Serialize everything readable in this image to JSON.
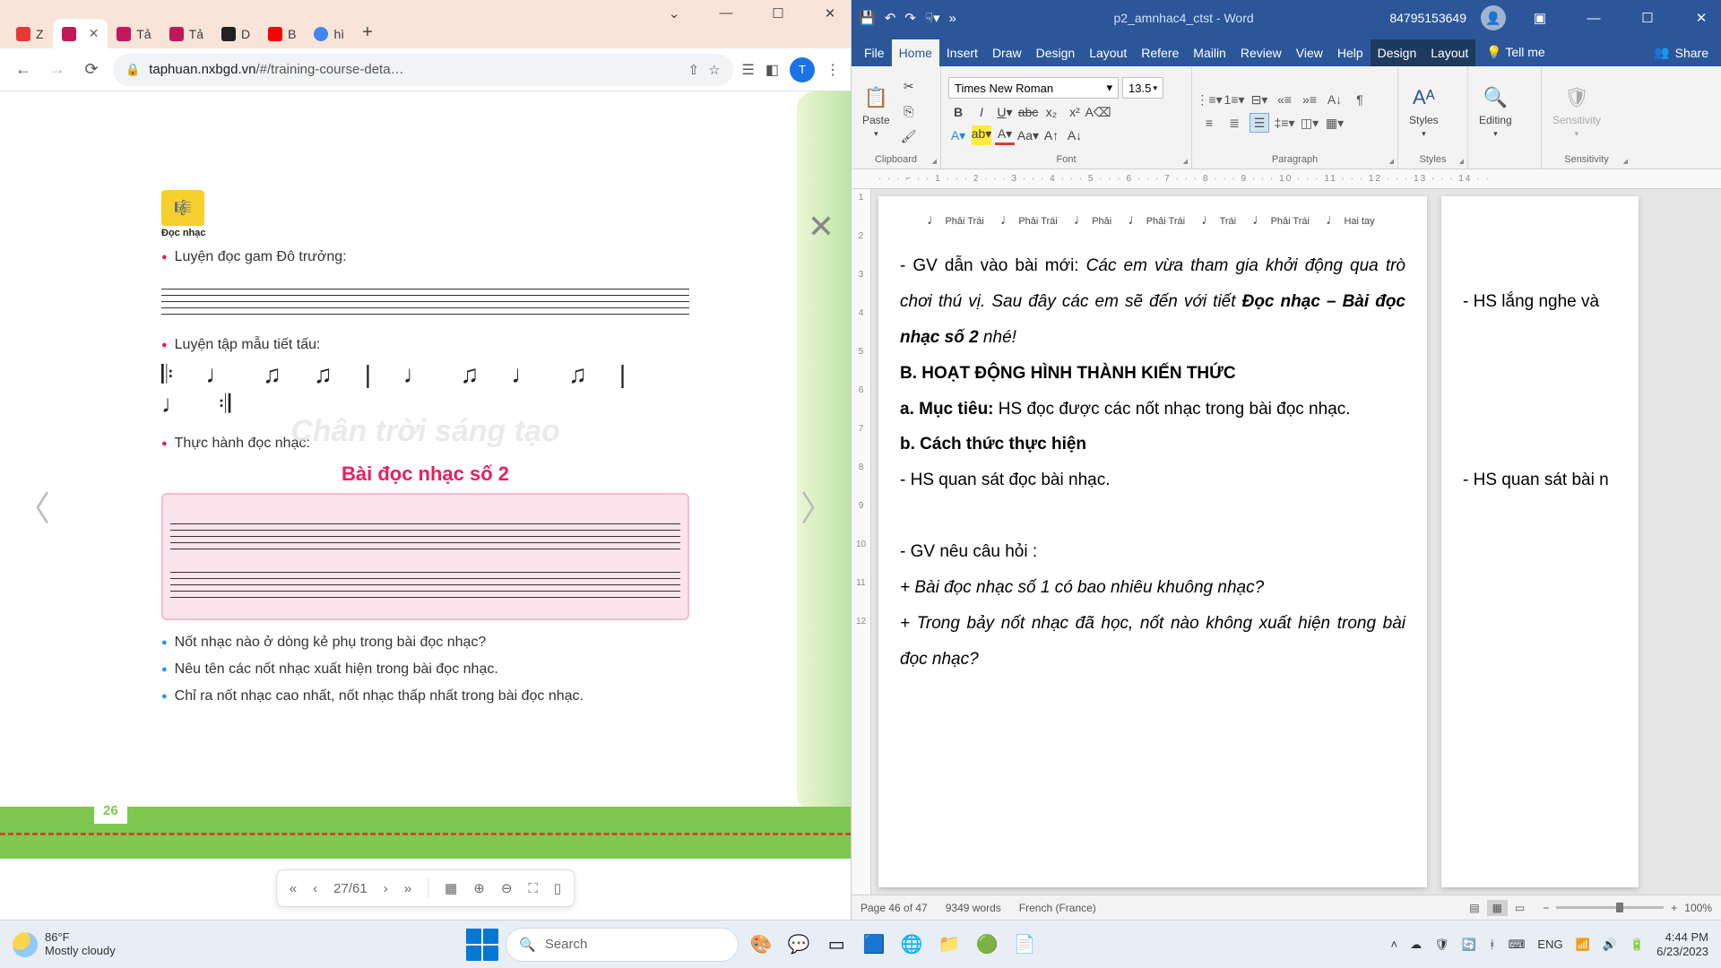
{
  "chrome": {
    "tabs": [
      {
        "label": "Z",
        "fav_color": "#e53935"
      },
      {
        "label": "",
        "fav_color": "#c2185b",
        "active": true
      },
      {
        "label": "Tả",
        "fav_color": "#c2185b"
      },
      {
        "label": "Tả",
        "fav_color": "#c2185b"
      },
      {
        "label": "D",
        "fav_color": "#212121"
      },
      {
        "label": "B",
        "fav_color": "#ff0000"
      },
      {
        "label": "hì",
        "fav_color": "#4285f4"
      }
    ],
    "url_domain": "taphuan.nxbgd.vn",
    "url_path": "/#/training-course-deta…",
    "profile_letter": "T",
    "book": {
      "docnhac": "Đọc nhạc",
      "line1": "Luyện đọc gam Đô trưởng:",
      "line2": "Luyện tập mẫu tiết tấu:",
      "line3": "Thực hành đọc nhạc:",
      "song_title": "Bài đọc nhạc số 2",
      "watermark": "Chân trời sáng tạo",
      "q1": "Nốt nhạc nào ở dòng kẻ phụ trong bài đọc nhạc?",
      "q2": "Nêu tên các nốt nhạc xuất hiện trong bài đọc nhạc.",
      "q3": "Chỉ ra nốt nhạc cao nhất, nốt nhạc thấp nhất trong bài đọc nhạc.",
      "page_number": "26"
    },
    "pdf_toolbar": {
      "page": "27/61"
    }
  },
  "word": {
    "doc_name": "p2_amnhac4_ctst  -  Word",
    "account_id": "84795153649",
    "tabs": [
      "File",
      "Home",
      "Insert",
      "Draw",
      "Design",
      "Layout",
      "Refere",
      "Mailin",
      "Review",
      "View",
      "Help",
      "Design",
      "Layout"
    ],
    "tell_me": "Tell me",
    "share": "Share",
    "font_name": "Times New Roman",
    "font_size": "13.5",
    "groups": {
      "clipboard": "Clipboard",
      "font": "Font",
      "paragraph": "Paragraph",
      "styles": "Styles",
      "editing": "Editing",
      "sensitivity": "Sensitivity"
    },
    "paste": "Paste",
    "styles_btn": "Styles",
    "editing_btn": "Editing",
    "sensitivity_btn": "Sensitivity",
    "ruler_h": "· · · ⌐ · · 1 · · · 2 · · · 3 · · · 4 · · · 5 · · · 6 · · · 7 · · · 8 · · · 9 · · · 10 · · · 11 · · · 12 · · · 13 · · · 14 · ·",
    "ruler_v": [
      "1",
      "·",
      "2",
      "·",
      "3",
      "·",
      "4",
      "·",
      "5",
      "·",
      "6",
      "·",
      "7",
      "·",
      "8",
      "·",
      "9",
      "·",
      "10",
      "·",
      "11",
      "·",
      "12"
    ],
    "notes": [
      "Phải Trái",
      "Phải Trái",
      "Phải",
      "Phải Trái",
      "Trái",
      "Phải Trái",
      "Hai tay"
    ],
    "body": {
      "l1a": "- GV dẫn vào bài mới: ",
      "l1b": "Các em vừa tham gia khởi động qua trò chơi thú vị. Sau đây các em sẽ đến với tiết ",
      "l1c": "Đọc nhạc – Bài đọc nhạc số 2",
      "l1d": " nhé!",
      "l2": "B. HOẠT ĐỘNG HÌNH THÀNH KIẾN THỨC",
      "l3a": "a. Mục tiêu: ",
      "l3b": "HS đọc được các nốt nhạc trong bài đọc nhạc.",
      "l4": "b. Cách thức thực hiện",
      "l5": "- HS quan sát đọc bài nhạc.",
      "l6": "- GV nêu câu hỏi :",
      "l7": "+ Bài đọc nhạc số 1 có bao nhiêu khuông nhạc?",
      "l8": "+ Trong bảy nốt nhạc đã học, nốt nào không xuất hiện trong bài đọc nhạc?",
      "r1": "- HS lắng nghe và",
      "r2": "- HS quan sát bài n"
    },
    "status": {
      "page": "Page 46 of 47",
      "words": "9349 words",
      "lang": "French (France)",
      "zoom": "100%"
    }
  },
  "taskbar": {
    "temp": "86°F",
    "weather": "Mostly cloudy",
    "search": "Search",
    "lang": "ENG",
    "time": "4:44 PM",
    "date": "6/23/2023"
  }
}
